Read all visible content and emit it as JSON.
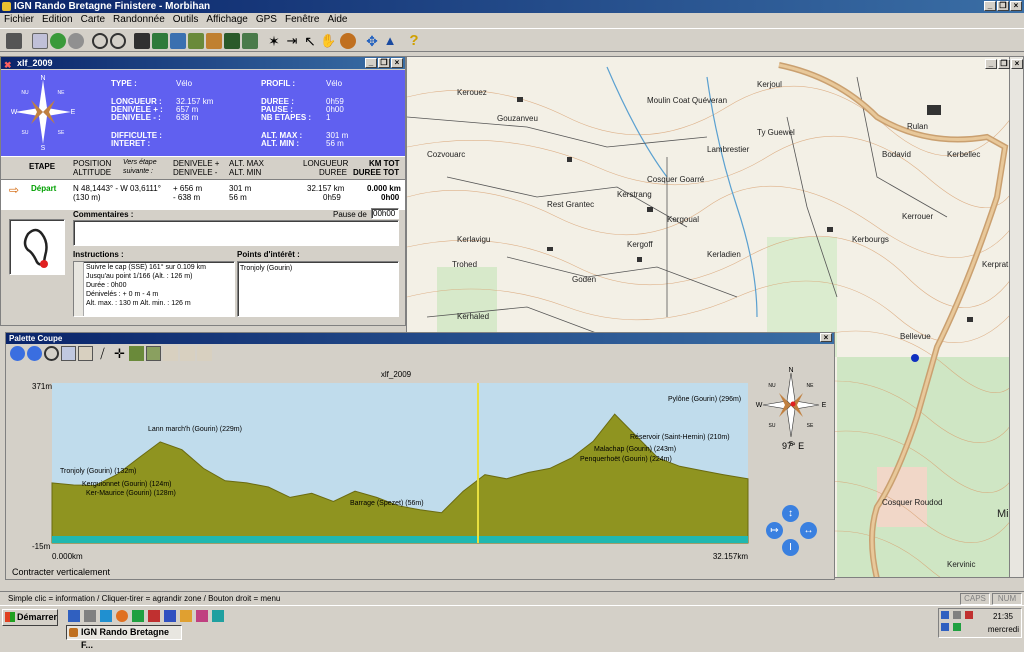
{
  "app": {
    "title": "IGN Rando Bretagne Finistere - Morbihan",
    "menus": [
      "Fichier",
      "Edition",
      "Carte",
      "Randonnée",
      "Outils",
      "Affichage",
      "GPS",
      "Fenêtre",
      "Aide"
    ]
  },
  "route_window": {
    "title": "xlf_2009",
    "summary": {
      "type_label": "TYPE :",
      "type_value": "Vélo",
      "profil_label": "PROFIL :",
      "profil_value": "Vélo",
      "longueur_label": "LONGUEUR :",
      "longueur_value": "32.157 km",
      "deniv_plus_label": "DENIVELE + :",
      "deniv_plus_value": "657 m",
      "deniv_minus_label": "DENIVELE - :",
      "deniv_minus_value": "638 m",
      "duree_label": "DUREE :",
      "duree_value": "0h59",
      "pause_label": "PAUSE :",
      "pause_value": "0h00",
      "nb_etapes_label": "NB ETAPES :",
      "nb_etapes_value": "1",
      "difficulte_label": "DIFFICULTE :",
      "interet_label": "INTERET :",
      "alt_max_label": "ALT. MAX :",
      "alt_max_value": "301 m",
      "alt_min_label": "ALT. MIN :",
      "alt_min_value": "56 m"
    },
    "headers": {
      "etape": "ETAPE",
      "position": "POSITION",
      "altitude": "ALTITUDE",
      "vers_etape": "Vers étape",
      "suivante": "suivante :",
      "denivele_plus": "DENIVELE +",
      "denivele_minus": "DENIVELE -",
      "alt_max": "ALT. MAX",
      "alt_min": "ALT. MIN",
      "longueur": "LONGUEUR",
      "duree": "DUREE",
      "km_tot": "KM TOT",
      "duree_tot": "DUREE TOT"
    },
    "step": {
      "name": "Départ",
      "position": "N 48,1443° - W 03,6111°",
      "altitude": "(130 m)",
      "deniv_plus": "+ 656 m",
      "deniv_minus": "- 638 m",
      "alt_max": "301 m",
      "alt_min": "56 m",
      "longueur": "32.157 km",
      "duree": "0h59",
      "km_tot": "0.000 km",
      "duree_tot": "0h00"
    },
    "commentaires_label": "Commentaires :",
    "pause_de_label": "Pause de",
    "pause_de_value": "00h00",
    "instructions_label": "Instructions :",
    "instructions": [
      "Suivre le cap (SSE) 161° sur 0.109 km",
      "Jusqu'au point 1/166 (Alt. : 126 m)",
      "Durée : 0h00",
      "Dénivelés : + 0 m   - 4 m",
      "Alt. max. : 130 m   Alt. min. : 126 m"
    ],
    "poi_label": "Points d'intérêt :",
    "poi": [
      "Tronjoly (Gourin)"
    ]
  },
  "coupe": {
    "title": "Palette Coupe",
    "chart_title": "xlf_2009",
    "y_top": "371m",
    "y_bottom": "-15m",
    "x_start": "0.000km",
    "x_end": "32.157km",
    "heading": "97° E",
    "footer": "Contracter verticalement",
    "labels": [
      "Tronjoly (Gourin) (132m)",
      "Kerguionnet (Gourin) (124m)",
      "Ker-Maurice (Gourin) (128m)",
      "Lann march'h (Gourin) (229m)",
      "Barrage (Spezet) (56m)",
      "Pylône (Gourin) (296m)",
      "Réservoir (Saint-Hernin) (210m)",
      "Malachap (Gourin) (243m)",
      "Penquerhoët (Gourin) (224m)"
    ]
  },
  "compass": {
    "n": "N",
    "s": "S",
    "e": "E",
    "w": "W",
    "ne": "NE",
    "nw": "NU",
    "se": "SE",
    "sw": "SU"
  },
  "map_labels": [
    "Kerouez",
    "Gouzanveu",
    "Moulin Coat Quéveran",
    "Kerjoul",
    "Cozvouarc",
    "Lambrestier",
    "Cosquer Goarré",
    "Kerbellec",
    "Bodavid",
    "Kerstrang",
    "Rest Grantec",
    "Kergoual",
    "Kerlavigu",
    "Kergoff",
    "Kerladien",
    "Trohed",
    "Goden",
    "Kerbourgs",
    "Kerrouer",
    "Kerhaled",
    "Bellevue",
    "Minez",
    "Ty Guewel",
    "Rulan",
    "Kervinic",
    "Cosquer Roudod",
    "Kerprat"
  ],
  "status": {
    "text": "Simple clic = information / Cliquer-tirer = agrandir zone / Bouton droit = menu",
    "caps": "CAPS",
    "num": "NUM"
  },
  "taskbar": {
    "start": "Démarrer",
    "task": "IGN Rando Bretagne F...",
    "time": "21:35",
    "day": "mercredi"
  },
  "chart_data": {
    "type": "area",
    "title": "xlf_2009",
    "xlabel": "",
    "ylabel": "",
    "x": [
      0,
      1,
      2,
      3,
      4,
      5,
      6,
      7,
      8,
      9,
      10,
      11,
      12,
      13,
      14,
      15,
      16,
      17,
      18,
      19,
      20,
      21,
      22,
      23,
      24,
      25,
      26,
      27,
      28,
      29,
      30,
      31,
      32.157
    ],
    "series": [
      {
        "values": [
          130,
          125,
          124,
          150,
          190,
          229,
          210,
          165,
          135,
          130,
          120,
          95,
          105,
          85,
          110,
          95,
          75,
          65,
          58,
          110,
          150,
          140,
          155,
          165,
          190,
          230,
          296,
          243,
          190,
          170,
          160,
          150,
          140
        ]
      }
    ],
    "xlim": [
      0,
      32.157
    ],
    "ylim": [
      -15,
      371
    ]
  }
}
